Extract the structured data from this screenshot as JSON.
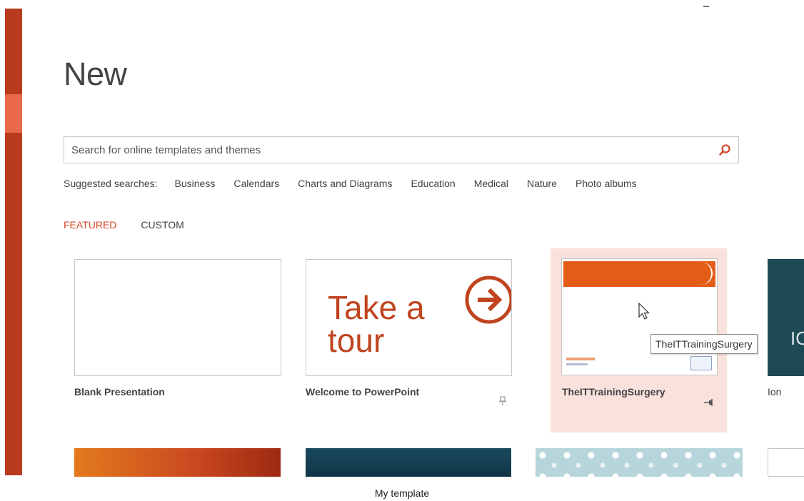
{
  "page": {
    "title": "New"
  },
  "search": {
    "placeholder": "Search for online templates and themes"
  },
  "suggested": {
    "label": "Suggested searches:",
    "items": [
      "Business",
      "Calendars",
      "Charts and Diagrams",
      "Education",
      "Medical",
      "Nature",
      "Photo albums"
    ]
  },
  "tabs": [
    {
      "label": "FEATURED",
      "active": true
    },
    {
      "label": "CUSTOM",
      "active": false
    }
  ],
  "templates": [
    {
      "name": "Blank Presentation"
    },
    {
      "name": "Welcome to PowerPoint",
      "thumb_text": [
        "Take a",
        "tour"
      ]
    },
    {
      "name": "TheITTrainingSurgery",
      "tooltip": "TheITTrainingSurgery"
    },
    {
      "name": "Ion",
      "thumb_text": "IO"
    }
  ],
  "caption": "My template",
  "colors": {
    "accent": "#d24726",
    "sidebar": "#b83b1e",
    "highlight": "#f9e1dc"
  }
}
